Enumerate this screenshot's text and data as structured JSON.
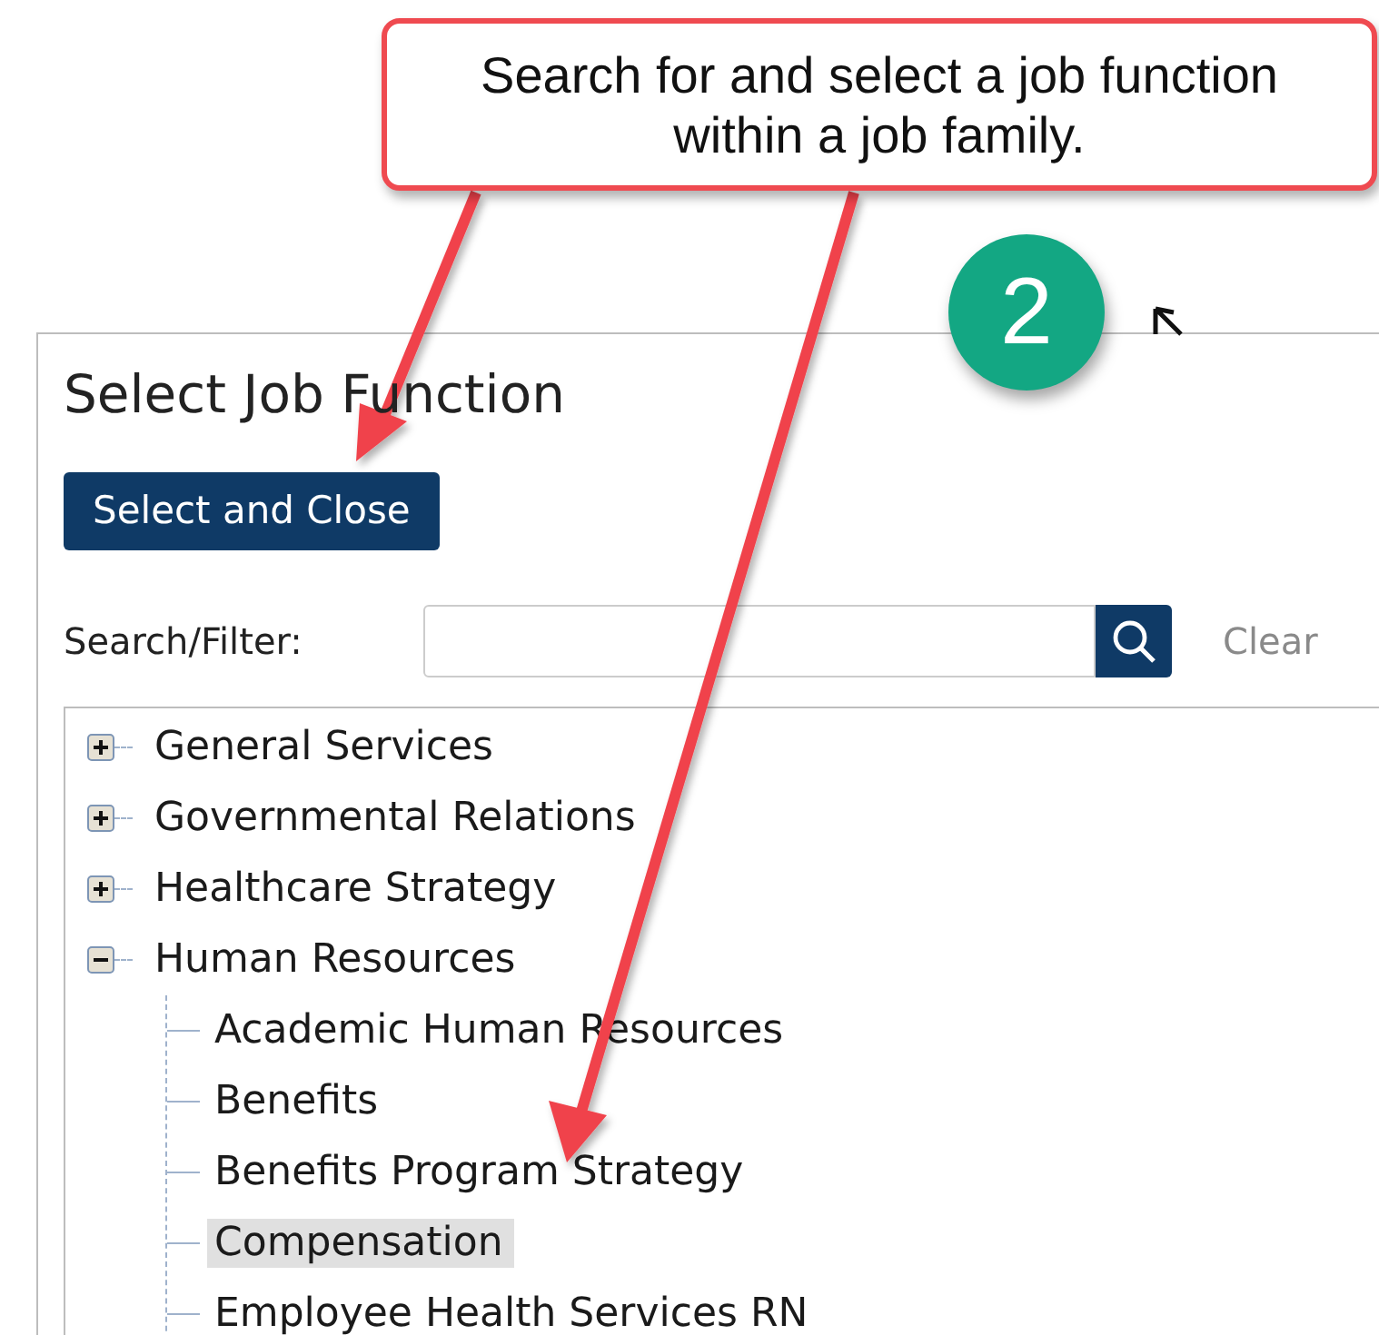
{
  "dialog": {
    "title": "Select Job Function",
    "select_button": "Select and Close",
    "search": {
      "label": "Search/Filter:"
    },
    "clear_button": "Clear"
  },
  "tree": [
    {
      "label": "General Services",
      "expanded": false,
      "selected": false
    },
    {
      "label": "Governmental Relations",
      "expanded": false,
      "selected": false
    },
    {
      "label": "Healthcare Strategy",
      "expanded": false,
      "selected": false
    },
    {
      "label": "Human Resources",
      "expanded": true,
      "selected": false,
      "children": [
        {
          "label": "Academic Human Resources",
          "selected": false
        },
        {
          "label": "Benefits",
          "selected": false
        },
        {
          "label": "Benefits Program Strategy",
          "selected": false
        },
        {
          "label": "Compensation",
          "selected": true
        },
        {
          "label": "Employee Health Services RN",
          "selected": false
        }
      ]
    }
  ],
  "callout": {
    "text": "Search for and select a job function within a job family."
  },
  "step_badge": {
    "number": "2"
  }
}
